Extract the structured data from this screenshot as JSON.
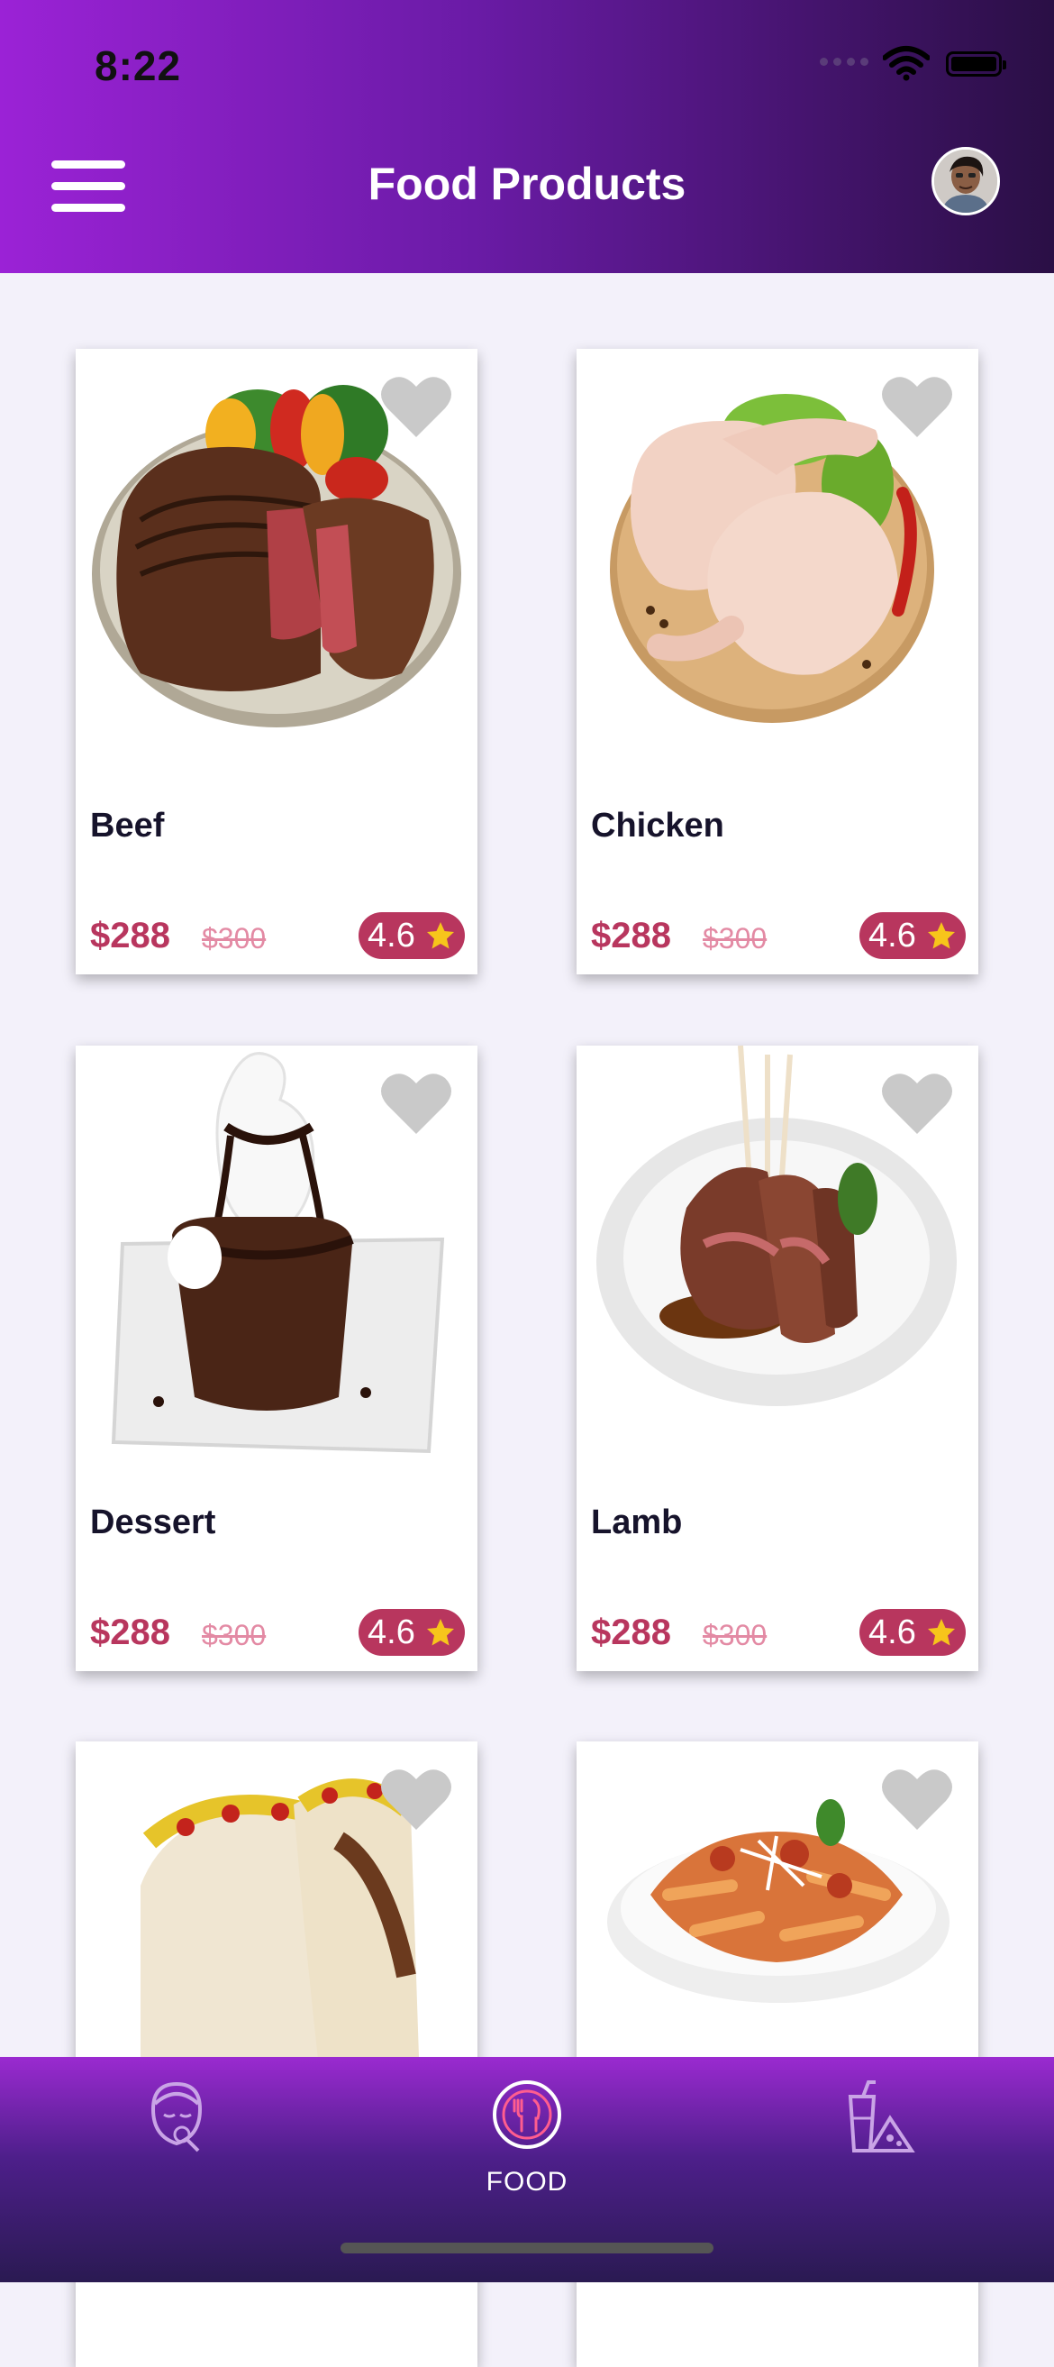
{
  "status_bar": {
    "time": "8:22"
  },
  "header": {
    "title": "Food Products"
  },
  "products": [
    {
      "name": "Beef",
      "price": "$288",
      "old_price": "$300",
      "rating": "4.6"
    },
    {
      "name": "Chicken",
      "price": "$288",
      "old_price": "$300",
      "rating": "4.6"
    },
    {
      "name": "Dessert",
      "price": "$288",
      "old_price": "$300",
      "rating": "4.6"
    },
    {
      "name": "Lamb",
      "price": "$288",
      "old_price": "$300",
      "rating": "4.6"
    },
    {
      "name": "",
      "price": "",
      "old_price": "",
      "rating": ""
    },
    {
      "name": "",
      "price": "",
      "old_price": "",
      "rating": ""
    }
  ],
  "bottom_nav": {
    "items": [
      {
        "icon": "beauty-face-icon",
        "label": ""
      },
      {
        "icon": "food-utensils-icon",
        "label": "FOOD"
      },
      {
        "icon": "drinks-snacks-icon",
        "label": ""
      }
    ]
  },
  "colors": {
    "header_gradient": [
      "#9b22d6",
      "#2a0f45"
    ],
    "price": "#b8365e",
    "old_price": "#e38aa4",
    "badge": "#b8365e",
    "star": "#f7c51b",
    "heart": "#c9c9c9",
    "nav_active": "#ff5d8f"
  }
}
